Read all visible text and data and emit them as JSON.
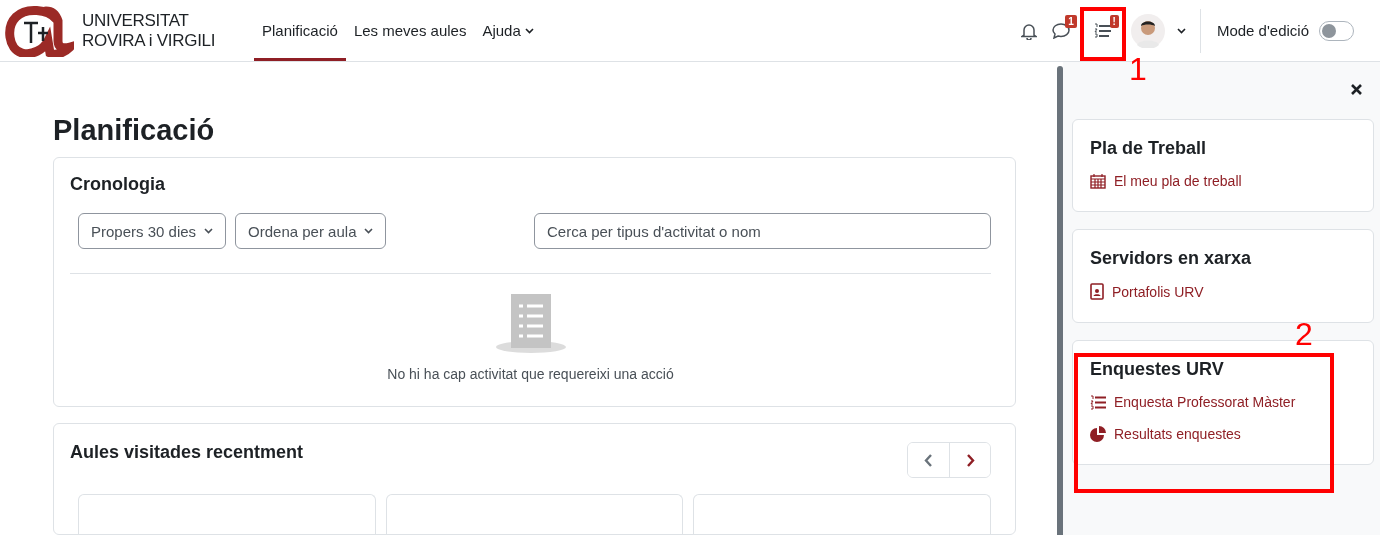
{
  "header": {
    "logo": {
      "line1": "UNIVERSITAT",
      "line2": "ROVIRA i VIRGILI"
    },
    "nav": [
      {
        "label": "Planificació",
        "selected": true,
        "dropdown": false
      },
      {
        "label": "Les meves aules",
        "selected": false,
        "dropdown": false
      },
      {
        "label": "Ajuda",
        "selected": false,
        "dropdown": true
      }
    ],
    "message_badge": "1",
    "plan_badge": "!",
    "edit_mode": {
      "label": "Mode d'edició",
      "on": false
    }
  },
  "page_title": "Planificació",
  "timeline": {
    "title": "Cronologia",
    "filters": [
      "Propers 30 dies",
      "Ordena per aula"
    ],
    "search": {
      "placeholder": "Cerca per tipus d'activitat o nom"
    },
    "empty_text": "No hi ha cap activitat que requereixi una acció"
  },
  "recent": {
    "title": "Aules visitades recentment"
  },
  "drawer": {
    "blocks": [
      {
        "title": "Pla de Treball",
        "links": [
          {
            "label": "El meu pla de treball",
            "kind": "calendar"
          }
        ]
      },
      {
        "title": "Servidors en xarxa",
        "links": [
          {
            "label": "Portafolis URV",
            "kind": "badge"
          }
        ]
      },
      {
        "title": "Enquestes URV",
        "links": [
          {
            "label": "Enquesta Professorat Màster",
            "kind": "list"
          },
          {
            "label": "Resultats enquestes",
            "kind": "pie"
          }
        ]
      }
    ]
  },
  "annotations": [
    {
      "label": "1"
    },
    {
      "label": "2"
    }
  ]
}
